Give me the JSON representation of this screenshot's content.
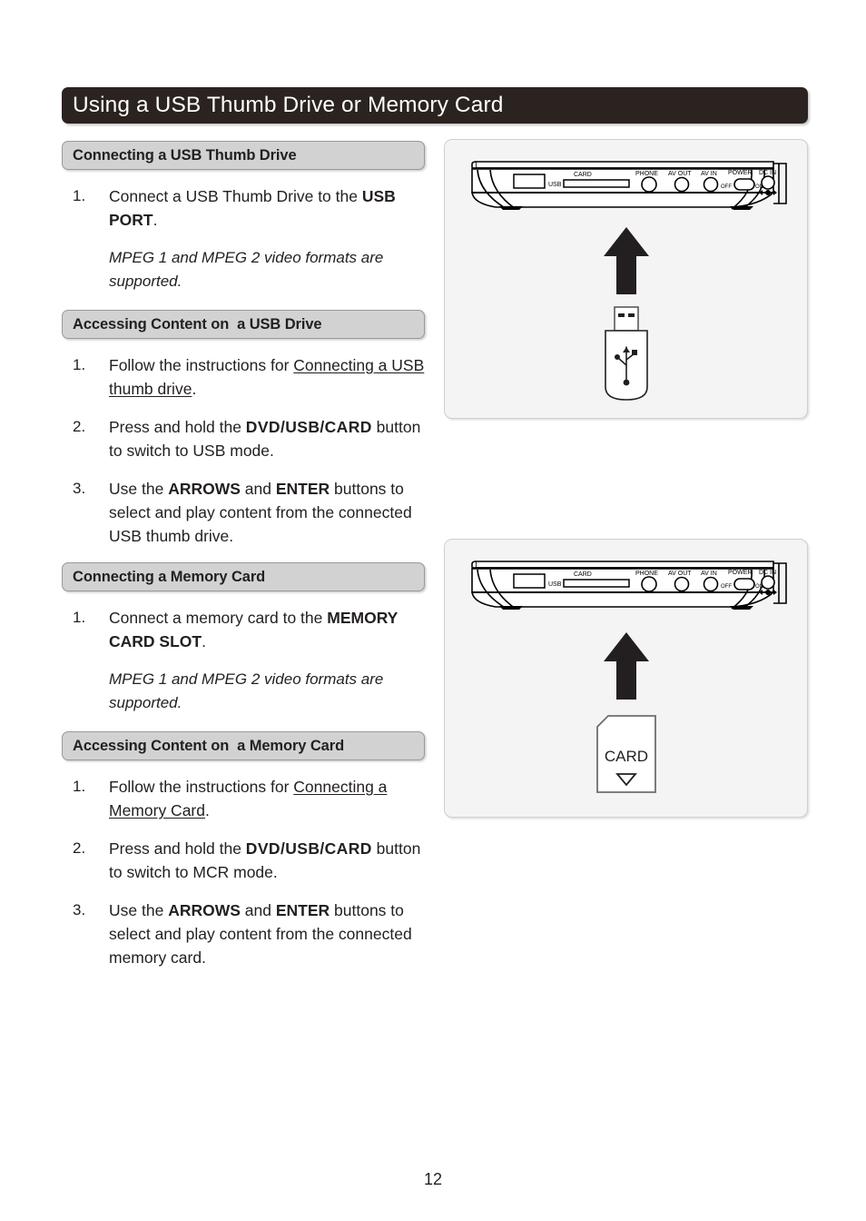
{
  "page": {
    "title": "Using a USB Thumb Drive or Memory Card",
    "page_number": "12"
  },
  "sections": [
    {
      "bar_label": "Connecting a USB Thumb Drive",
      "steps": [
        {
          "num": "1.",
          "parts": [
            {
              "text": "Connect a USB Thumb Drive to the ",
              "style": "normal"
            },
            {
              "text": "USB PORT",
              "style": "bold"
            },
            {
              "text": ".",
              "style": "normal"
            }
          ]
        }
      ],
      "note": "MPEG 1 and MPEG 2 video formats are supported."
    },
    {
      "bar_label": "Accessing Content on  a USB Drive",
      "steps": [
        {
          "num": "1.",
          "parts": [
            {
              "text": "Follow the instructions for ",
              "style": "normal"
            },
            {
              "text": "Connecting a USB thumb drive",
              "style": "underline"
            },
            {
              "text": ".",
              "style": "normal"
            }
          ]
        },
        {
          "num": "2.",
          "parts": [
            {
              "text": "Press and hold the ",
              "style": "normal"
            },
            {
              "text": "DVD/USB/CARD",
              "style": "bold-spaced"
            },
            {
              "text": " button to switch to USB mode.",
              "style": "normal"
            }
          ]
        },
        {
          "num": "3.",
          "parts": [
            {
              "text": "Use the ",
              "style": "normal"
            },
            {
              "text": "ARROWS",
              "style": "bold"
            },
            {
              "text": " and ",
              "style": "normal"
            },
            {
              "text": "ENTER",
              "style": "bold"
            },
            {
              "text": " buttons to select and play content from the connected USB thumb drive.",
              "style": "normal"
            }
          ]
        }
      ],
      "note": ""
    },
    {
      "bar_label": "Connecting a Memory Card",
      "steps": [
        {
          "num": "1.",
          "parts": [
            {
              "text": "Connect a memory card to the ",
              "style": "normal"
            },
            {
              "text": "MEMORY CARD SLOT",
              "style": "bold"
            },
            {
              "text": ".",
              "style": "normal"
            }
          ]
        }
      ],
      "note": "MPEG 1 and MPEG 2 video formats are supported."
    },
    {
      "bar_label": "Accessing Content on  a Memory Card",
      "steps": [
        {
          "num": "1.",
          "parts": [
            {
              "text": "Follow the instructions for ",
              "style": "normal"
            },
            {
              "text": "Connecting a Memory Card",
              "style": "underline"
            },
            {
              "text": ".",
              "style": "normal"
            }
          ]
        },
        {
          "num": "2.",
          "parts": [
            {
              "text": "Press and hold the ",
              "style": "normal"
            },
            {
              "text": "DVD/USB/CARD",
              "style": "bold-spaced"
            },
            {
              "text": " button to switch to MCR mode.",
              "style": "normal"
            }
          ]
        },
        {
          "num": "3.",
          "parts": [
            {
              "text": "Use the ",
              "style": "normal"
            },
            {
              "text": "ARROWS",
              "style": "bold"
            },
            {
              "text": " and ",
              "style": "normal"
            },
            {
              "text": "ENTER",
              "style": "bold"
            },
            {
              "text": " buttons to select and play content from the connected memory card.",
              "style": "normal"
            }
          ]
        }
      ],
      "note": ""
    }
  ],
  "illustrations": {
    "device_port_labels": {
      "usb": "USB",
      "card": "CARD",
      "phone": "PHONE",
      "av_out": "AV OUT",
      "av_in": "AV IN",
      "power": "POWER",
      "power_off": "OFF",
      "power_on": "ON",
      "dc_in": "DC IN"
    },
    "usb_panel": {
      "arrow": "arrow-up",
      "device_label": "usb-thumb-drive"
    },
    "card_panel": {
      "arrow": "arrow-up",
      "card_label": "CARD"
    }
  },
  "colors": {
    "title_bar": "#2b2320",
    "section_bar": "#d2d2d2",
    "panel_bg": "#f4f4f4",
    "text": "#231f20"
  }
}
